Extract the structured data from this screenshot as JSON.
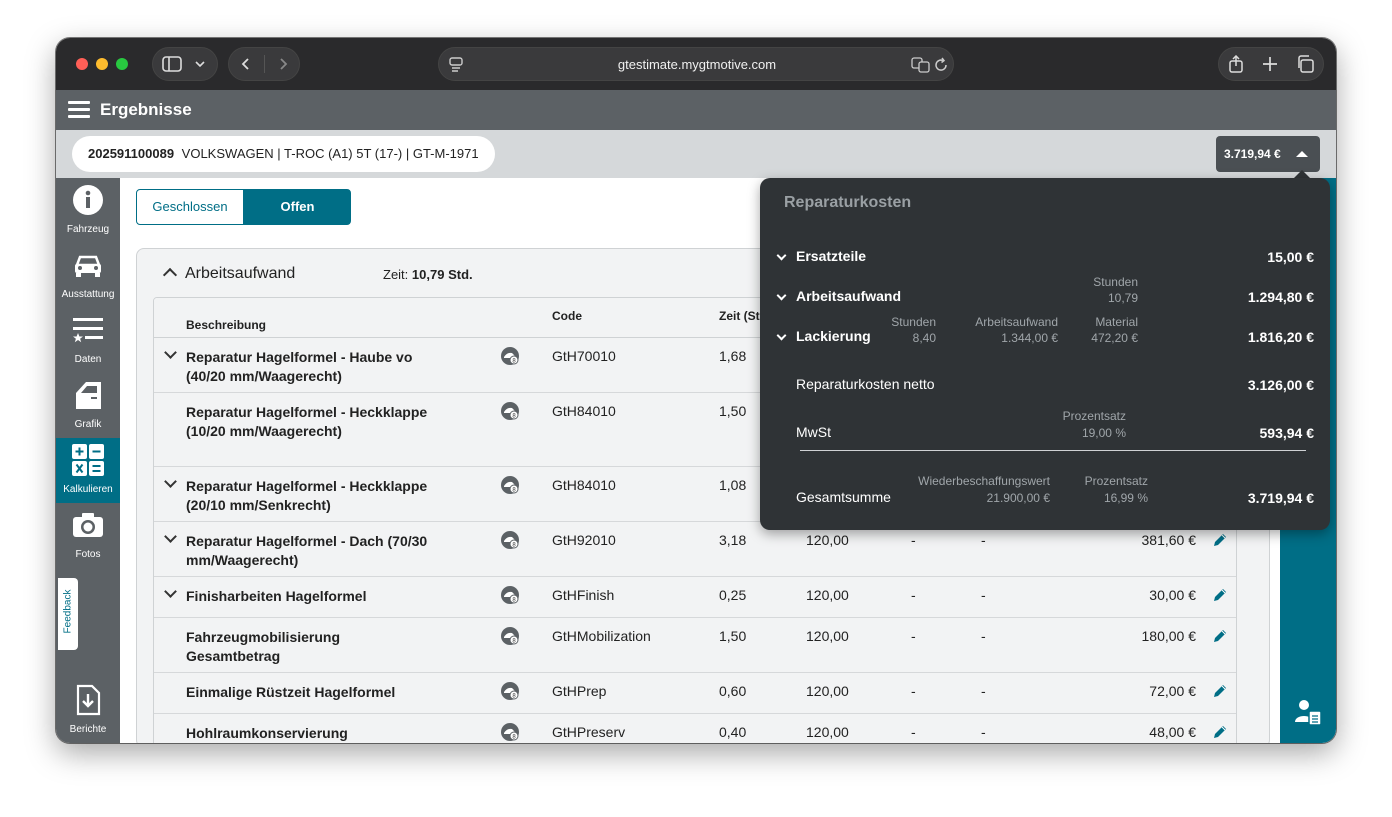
{
  "browser": {
    "url": "gtestimate.mygtmotive.com"
  },
  "app": {
    "title": "Ergebnisse"
  },
  "vehicle": {
    "id": "202591100089",
    "description": "VOLKSWAGEN | T-ROC (A1) 5T (17-) | GT-M-1971",
    "total": "3.719,94 €"
  },
  "sidebar": {
    "items": [
      {
        "label": "Fahrzeug",
        "icon": "info-icon"
      },
      {
        "label": "Ausstattung",
        "icon": "car-icon"
      },
      {
        "label": "Daten",
        "icon": "list-star-icon"
      },
      {
        "label": "Grafik",
        "icon": "car-door-icon"
      },
      {
        "label": "Kalkulieren",
        "icon": "calculator-icon"
      },
      {
        "label": "Fotos",
        "icon": "camera-icon"
      },
      {
        "label": "Berichte",
        "icon": "download-file-icon"
      }
    ],
    "feedback": "Feedback"
  },
  "toggle": {
    "closed": "Geschlossen",
    "open": "Offen"
  },
  "section": {
    "title": "Arbeitsaufwand",
    "zeit_label": "Zeit:",
    "zeit_value": "10,79 Std."
  },
  "table": {
    "headers": {
      "beschreibung": "Beschreibung",
      "code": "Code",
      "zeit": "Zeit (St"
    },
    "rows": [
      {
        "desc": "Reparatur Hagelformel - Haube vo (40/20 mm/Waagerecht)",
        "code": "GtH70010",
        "zeit": "1,68",
        "satz": "",
        "d1": "",
        "d2": "",
        "amount": ""
      },
      {
        "desc": "Reparatur Hagelformel - Heckklappe (10/20 mm/Waagerecht)",
        "code": "GtH84010",
        "zeit": "1,50",
        "satz": "",
        "d1": "",
        "d2": "",
        "amount": ""
      },
      {
        "desc": "Reparatur Hagelformel - Heckklappe (20/10 mm/Senkrecht)",
        "code": "GtH84010",
        "zeit": "1,08",
        "satz": "",
        "d1": "",
        "d2": "",
        "amount": ""
      },
      {
        "desc": "Reparatur Hagelformel - Dach (70/30 mm/Waagerecht)",
        "code": "GtH92010",
        "zeit": "3,18",
        "satz": "120,00",
        "d1": "-",
        "d2": "-",
        "amount": "381,60 €"
      },
      {
        "desc": "Finisharbeiten Hagelformel",
        "code": "GtHFinish",
        "zeit": "0,25",
        "satz": "120,00",
        "d1": "-",
        "d2": "-",
        "amount": "30,00 €"
      },
      {
        "desc": "Fahrzeugmobilisierung Gesamtbetrag",
        "code": "GtHMobilization",
        "zeit": "1,50",
        "satz": "120,00",
        "d1": "-",
        "d2": "-",
        "amount": "180,00 €"
      },
      {
        "desc": "Einmalige Rüstzeit Hagelformel",
        "code": "GtHPrep",
        "zeit": "0,60",
        "satz": "120,00",
        "d1": "-",
        "d2": "-",
        "amount": "72,00 €"
      },
      {
        "desc": "Hohlraumkonservierung",
        "code": "GtHPreserv",
        "zeit": "0,40",
        "satz": "120,00",
        "d1": "-",
        "d2": "-",
        "amount": "48,00 €"
      }
    ]
  },
  "popup": {
    "title": "Reparaturkosten",
    "ersatzteile": {
      "label": "Ersatzteile",
      "value": "15,00 €"
    },
    "arbeitsaufwand": {
      "label": "Arbeitsaufwand",
      "stunden_label": "Stunden",
      "stunden": "10,79",
      "value": "1.294,80 €"
    },
    "lackierung": {
      "label": "Lackierung",
      "stunden_label": "Stunden",
      "stunden": "8,40",
      "aa_label": "Arbeitsaufwand",
      "aa": "1.344,00 €",
      "mat_label": "Material",
      "mat": "472,20 €",
      "value": "1.816,20 €"
    },
    "netto": {
      "label": "Reparaturkosten netto",
      "value": "3.126,00 €"
    },
    "mwst": {
      "label": "MwSt",
      "pct_label": "Prozentsatz",
      "pct": "19,00 %",
      "value": "593,94 €"
    },
    "gesamt": {
      "label": "Gesamtsumme",
      "wbw_label": "Wiederbeschaffungswert",
      "wbw": "21.900,00 €",
      "pct_label": "Prozentsatz",
      "pct": "16,99 %",
      "value": "3.719,94 €"
    }
  }
}
